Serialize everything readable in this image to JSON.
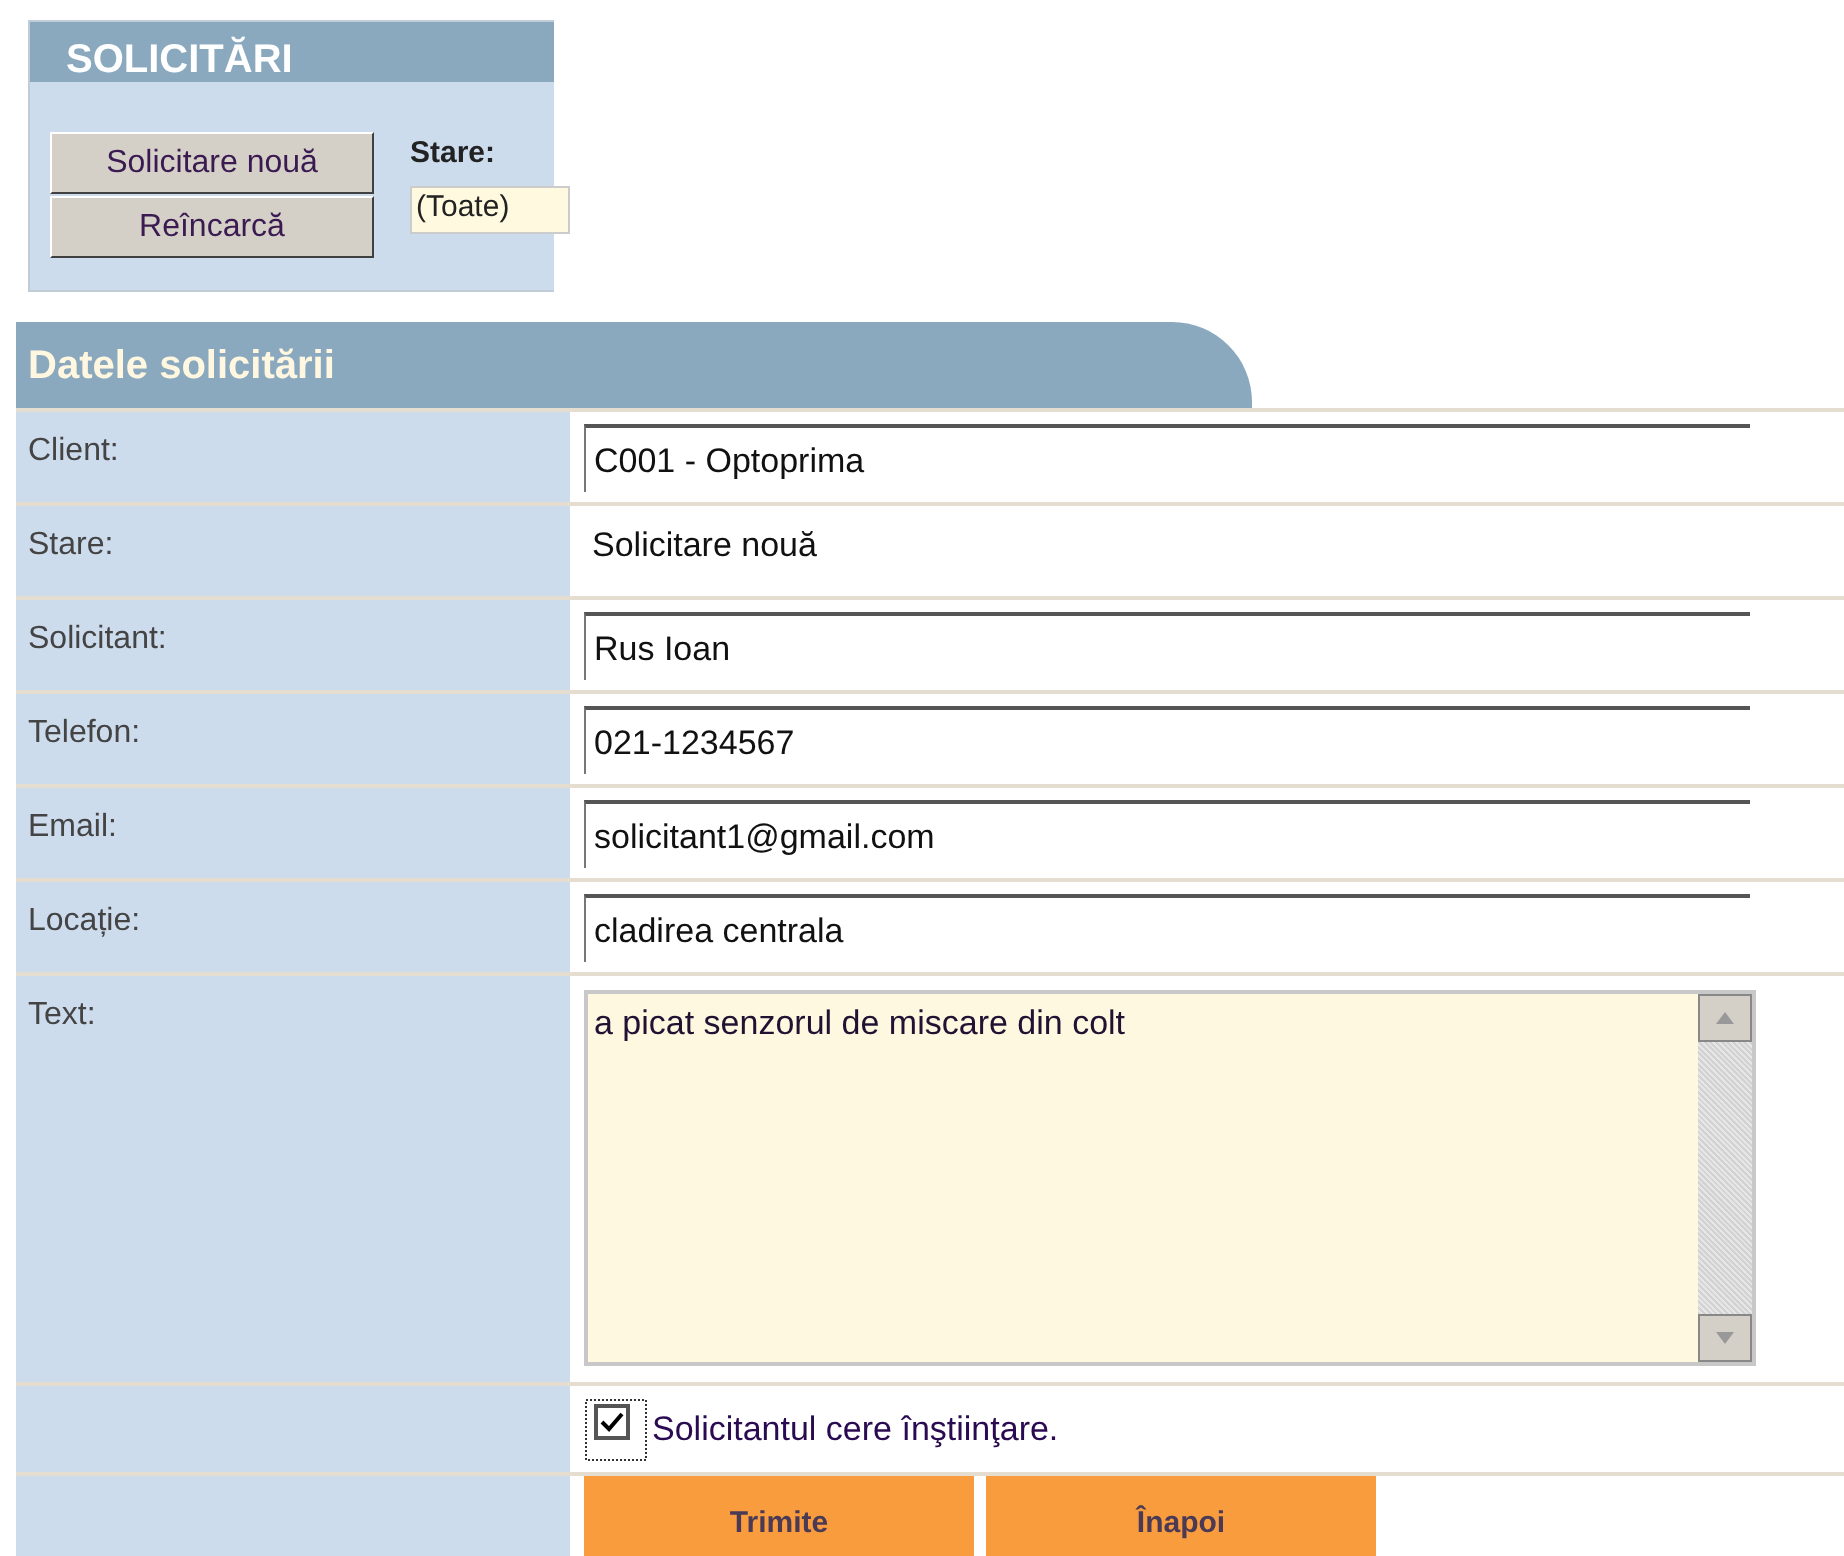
{
  "panel": {
    "title": "SOLICITĂRI",
    "buttons": [
      "Solicitare nouă",
      "Reîncarcă"
    ],
    "filter": {
      "label": "Stare:",
      "value": "(Toate)"
    }
  },
  "form": {
    "title": "Datele solicitării",
    "fields": [
      {
        "label": "Client:",
        "kind": "input",
        "value": "C001 - Optoprima"
      },
      {
        "label": "Stare:",
        "kind": "text",
        "value": "Solicitare nouă"
      },
      {
        "label": "Solicitant:",
        "kind": "input",
        "value": "Rus Ioan"
      },
      {
        "label": "Telefon:",
        "kind": "input",
        "value": "021-1234567"
      },
      {
        "label": "Email:",
        "kind": "input",
        "value": "solicitant1@gmail.com"
      },
      {
        "label": "Locație:",
        "kind": "input",
        "value": "cladirea centrala"
      },
      {
        "label": "Text:",
        "kind": "textarea",
        "value": "a picat senzorul de miscare din colt"
      }
    ],
    "notify": {
      "label": "Solicitantul cere înştiinţare.",
      "checked": true
    },
    "buttons": [
      "Trimite",
      "Înapoi"
    ]
  }
}
